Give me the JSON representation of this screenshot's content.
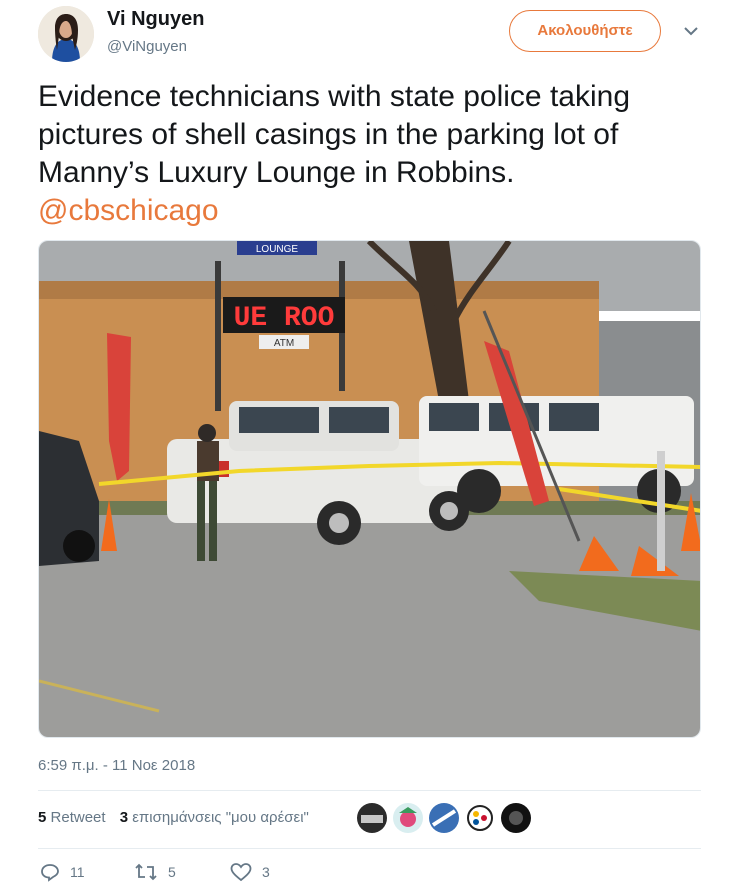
{
  "author": {
    "name": "Vi Nguyen",
    "handle": "@ViNguyen",
    "avatar_icon": "profile-photo-icon"
  },
  "follow_button": {
    "label": "Ακολουθήστε",
    "color": "#e8793c"
  },
  "tweet": {
    "text": "Evidence technicians with state police taking pictures of shell casings in the parking lot of Manny’s Luxury Lounge in Robbins.",
    "mention": "@cbschicago",
    "mention_color": "#e8793c"
  },
  "photo": {
    "sign_text": "UE ROO",
    "atm_text": "ATM",
    "top_sign_text": "LOUNGE"
  },
  "timestamp": "6:59 π.μ. - 11 Νοε 2018",
  "stats": {
    "retweets_count": "5",
    "retweets_label": "Retweet",
    "likes_count": "3",
    "likes_label": "επισημάνσεις \"μου αρέσει\""
  },
  "actions": {
    "replies": "11",
    "retweets": "5",
    "likes": "3"
  },
  "colors": {
    "accent": "#e8793c",
    "muted": "#657786",
    "text": "#14171a"
  }
}
